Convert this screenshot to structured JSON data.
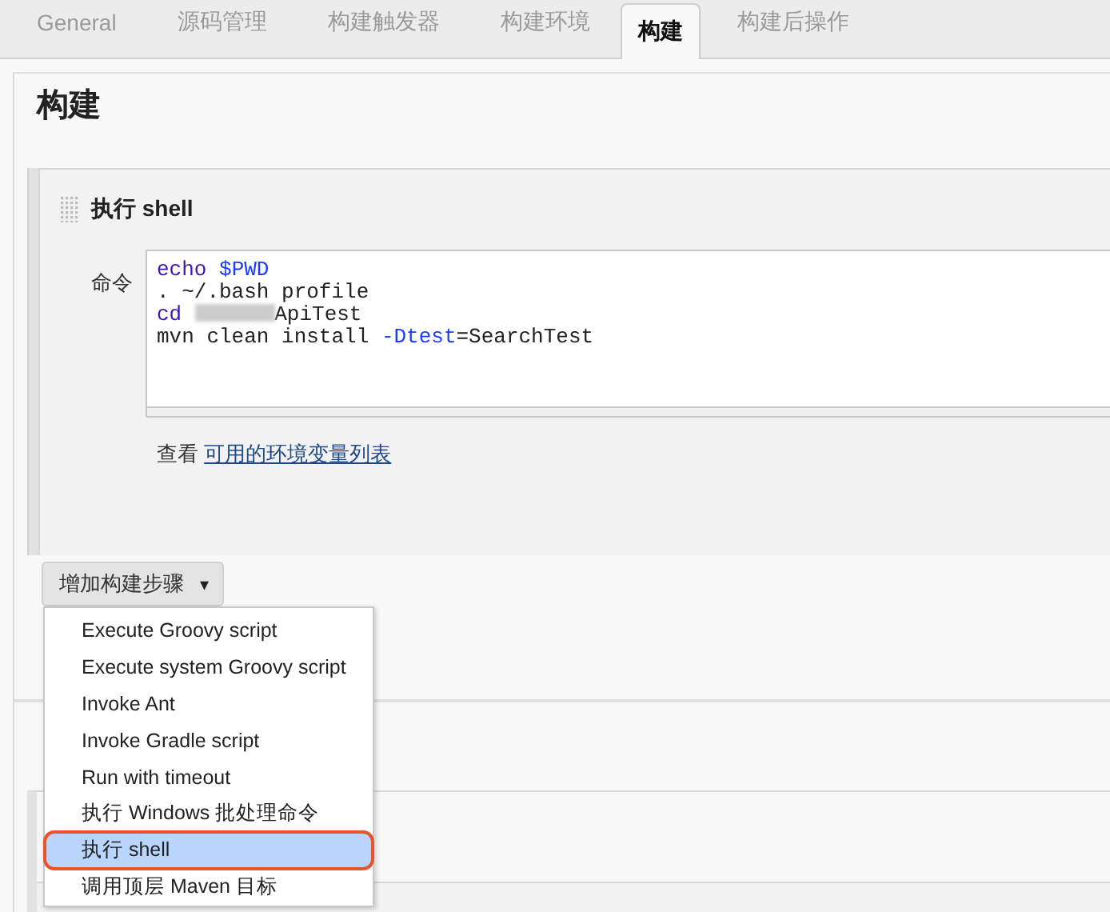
{
  "tabs": [
    {
      "label": "General",
      "selected": false
    },
    {
      "label": "源码管理",
      "selected": false
    },
    {
      "label": "构建触发器",
      "selected": false
    },
    {
      "label": "构建环境",
      "selected": false
    },
    {
      "label": "构建",
      "selected": true
    },
    {
      "label": "构建后操作",
      "selected": false
    }
  ],
  "section_title": "构建",
  "build_step": {
    "title": "执行 shell",
    "command_label": "命令",
    "command_lines": [
      [
        {
          "kind": "keyword",
          "text": "echo"
        },
        {
          "kind": "variable",
          "text": " $PWD"
        }
      ],
      [
        {
          "kind": "plain",
          "text": ". ~/.bash profile"
        }
      ],
      [
        {
          "kind": "keyword",
          "text": "cd"
        },
        {
          "kind": "redacted"
        },
        {
          "kind": "plain",
          "text": "ApiTest"
        }
      ],
      [
        {
          "kind": "plain",
          "text": "mvn clean install "
        },
        {
          "kind": "variable",
          "text": "-Dtest"
        },
        {
          "kind": "plain",
          "text": "=SearchTest"
        }
      ]
    ],
    "hint": "查看",
    "hint_link": "可用的环境变量列表"
  },
  "add_step_button": {
    "label": "增加构建步骤",
    "caret": "▾"
  },
  "dropdown_items": [
    {
      "label": "Execute Groovy script",
      "selected": false
    },
    {
      "label": "Execute system Groovy script",
      "selected": false
    },
    {
      "label": "Invoke Ant",
      "selected": false
    },
    {
      "label": "Invoke Gradle script",
      "selected": false
    },
    {
      "label": "Run with timeout",
      "selected": false
    },
    {
      "label": "执行 Windows 批处理命令",
      "selected": false
    },
    {
      "label": "执行 shell",
      "selected": true
    },
    {
      "label": "调用顶层 Maven 目标",
      "selected": false
    }
  ]
}
